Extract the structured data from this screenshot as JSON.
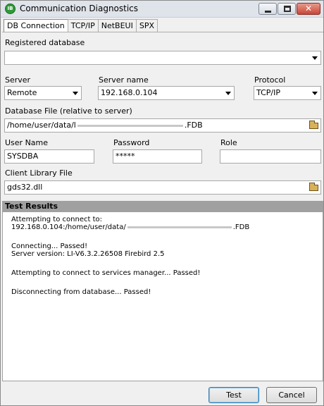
{
  "window": {
    "title": "Communication Diagnostics",
    "icon_text": "IB",
    "close_glyph": "✕"
  },
  "tabs": [
    {
      "label": "DB Connection"
    },
    {
      "label": "TCP/IP"
    },
    {
      "label": "NetBEUI"
    },
    {
      "label": "SPX"
    }
  ],
  "form": {
    "registered_database": {
      "label": "Registered database",
      "value": ""
    },
    "server": {
      "label": "Server",
      "value": "Remote"
    },
    "server_name": {
      "label": "Server name",
      "value": "192.168.0.104"
    },
    "protocol": {
      "label": "Protocol",
      "value": "TCP/IP"
    },
    "database_file": {
      "label": "Database File (relative to server)",
      "value_start": "/home/user/data/l",
      "value_end": ".FDB"
    },
    "user_name": {
      "label": "User Name",
      "value": "SYSDBA"
    },
    "password": {
      "label": "Password",
      "value": "*****"
    },
    "role": {
      "label": "Role",
      "value": ""
    },
    "client_library": {
      "label": "Client Library File",
      "value": "gds32.dll"
    }
  },
  "results": {
    "header": "Test Results",
    "lines": [
      "Attempting to connect to:",
      "",
      "",
      "Connecting... Passed!",
      "Server version: LI-V6.3.2.26508 Firebird 2.5",
      "",
      "Attempting to connect to services manager... Passed!",
      "",
      "Disconnecting from database... Passed!"
    ],
    "path_start": "192.168.0.104:/home/user/data/",
    "path_end": ".FDB"
  },
  "buttons": {
    "test": "Test",
    "cancel": "Cancel"
  }
}
